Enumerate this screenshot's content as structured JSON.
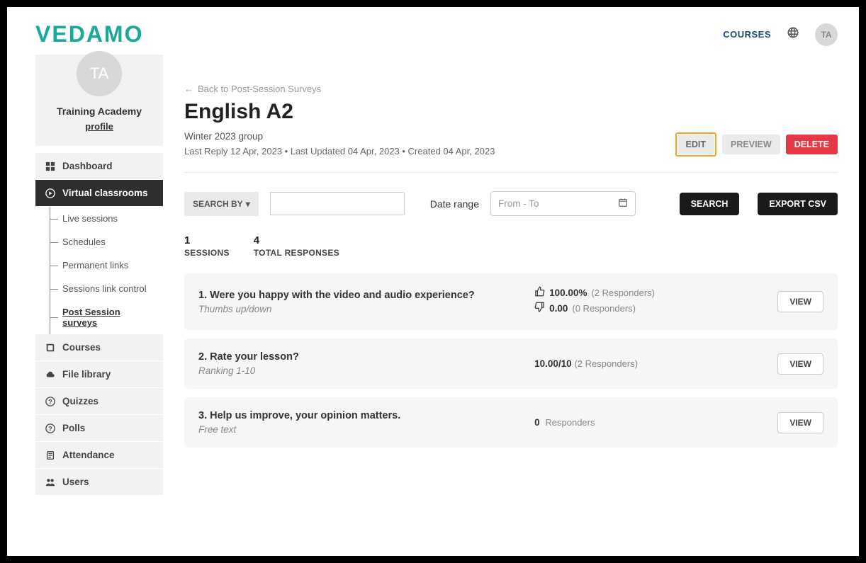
{
  "header": {
    "logo": "VEDAMO",
    "courses_link": "COURSES",
    "avatar_initials": "TA"
  },
  "profile": {
    "avatar_initials": "TA",
    "org_name": "Training Academy",
    "profile_link": "profile"
  },
  "nav": {
    "dashboard": "Dashboard",
    "virtual_classrooms": "Virtual classrooms",
    "sub": {
      "live_sessions": "Live sessions",
      "schedules": "Schedules",
      "permanent_links": "Permanent links",
      "sessions_link_control": "Sessions link control",
      "post_session_surveys": "Post Session surveys"
    },
    "courses": "Courses",
    "file_library": "File library",
    "quizzes": "Quizzes",
    "polls": "Polls",
    "attendance": "Attendance",
    "users": "Users"
  },
  "page": {
    "back_link": "Back to Post-Session Surveys",
    "title": "English A2",
    "group": "Winter 2023 group",
    "meta": "Last Reply 12 Apr, 2023 • Last Updated 04 Apr, 2023 • Created 04 Apr, 2023",
    "edit_btn": "EDIT",
    "preview_btn": "PREVIEW",
    "delete_btn": "DELETE"
  },
  "controls": {
    "search_by_label": "SEARCH BY",
    "daterange_label": "Date range",
    "daterange_placeholder": "From - To",
    "search_btn": "SEARCH",
    "export_btn": "EXPORT CSV"
  },
  "stats": {
    "sessions_num": "1",
    "sessions_label": "SESSIONS",
    "responses_num": "4",
    "responses_label": "TOTAL RESPONSES"
  },
  "questions": [
    {
      "title": "1. Were you happy with the video and audio experience?",
      "type": "Thumbs up/down",
      "up_pct": "100.00%",
      "up_resp": "(2 Responders)",
      "down_pct": "0.00",
      "down_resp": "(0 Responders)",
      "view": "VIEW"
    },
    {
      "title": "2. Rate your lesson?",
      "type": "Ranking 1-10",
      "score": "10.00/10",
      "resp": "(2 Responders)",
      "view": "VIEW"
    },
    {
      "title": "3. Help us improve, your opinion matters.",
      "type": "Free text",
      "count": "0",
      "resp": "Responders",
      "view": "VIEW"
    }
  ]
}
